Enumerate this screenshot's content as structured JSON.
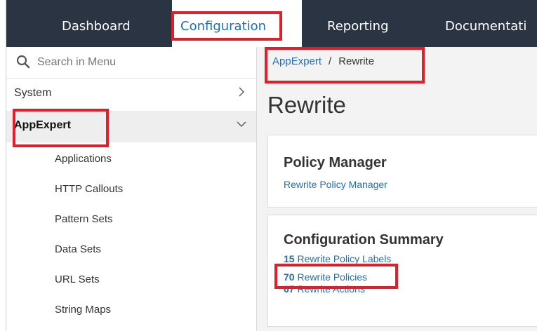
{
  "nav": {
    "tabs": [
      {
        "label": "Dashboard"
      },
      {
        "label": "Configuration",
        "active": true
      },
      {
        "label": "Reporting"
      },
      {
        "label": "Documentati"
      }
    ]
  },
  "sidebar": {
    "search_placeholder": "Search in Menu",
    "items": [
      {
        "label": "System",
        "expanded": false
      },
      {
        "label": "AppExpert",
        "expanded": true
      }
    ],
    "subitems": [
      "Applications",
      "HTTP Callouts",
      "Pattern Sets",
      "Data Sets",
      "URL Sets",
      "String Maps"
    ]
  },
  "breadcrumb": {
    "parent": "AppExpert",
    "separator": "/",
    "current": "Rewrite"
  },
  "page_title": "Rewrite",
  "policy_manager": {
    "heading": "Policy Manager",
    "link": "Rewrite Policy Manager"
  },
  "config_summary": {
    "heading": "Configuration Summary",
    "rows": [
      {
        "count": "15",
        "label": "Rewrite Policy Labels"
      },
      {
        "count": "70",
        "label": "Rewrite Policies"
      },
      {
        "count": "67",
        "label": "Rewrite Actions"
      }
    ]
  },
  "colors": {
    "nav_bg": "#2b3442",
    "link": "#1f6fb5",
    "highlight": "#e01f2b"
  }
}
